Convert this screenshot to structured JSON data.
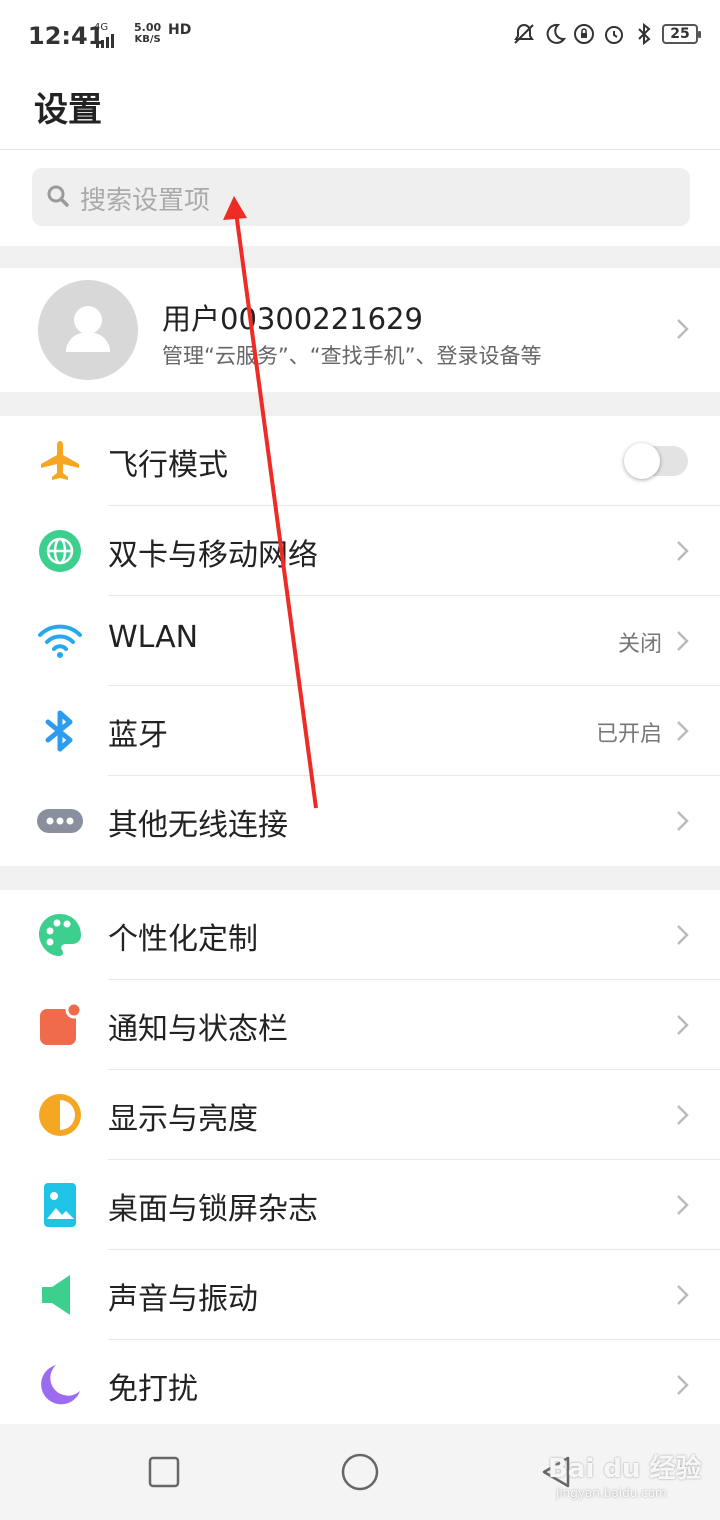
{
  "status_bar": {
    "time": "12:41",
    "network": "4G",
    "speed_value": "5.00",
    "speed_unit": "KB/S",
    "hd": "HD",
    "battery": "25"
  },
  "header": {
    "title": "设置"
  },
  "search": {
    "placeholder": "搜索设置项"
  },
  "account": {
    "name": "用户00300221629",
    "description": "管理“云服务”、“查找手机”、登录设备等"
  },
  "network_group": [
    {
      "label": "飞行模式",
      "icon": "airplane-icon",
      "control": "toggle",
      "on": false
    },
    {
      "label": "双卡与移动网络",
      "icon": "globe-icon"
    },
    {
      "label": "WLAN",
      "icon": "wifi-icon",
      "value": "关闭"
    },
    {
      "label": "蓝牙",
      "icon": "bluetooth-icon",
      "value": "已开启"
    },
    {
      "label": "其他无线连接",
      "icon": "more-dots-icon"
    }
  ],
  "system_group": [
    {
      "label": "个性化定制",
      "icon": "palette-icon"
    },
    {
      "label": "通知与状态栏",
      "icon": "notification-icon"
    },
    {
      "label": "显示与亮度",
      "icon": "brightness-icon"
    },
    {
      "label": "桌面与锁屏杂志",
      "icon": "wallpaper-icon"
    },
    {
      "label": "声音与振动",
      "icon": "speaker-icon"
    },
    {
      "label": "免打扰",
      "icon": "moon-icon"
    }
  ],
  "colors": {
    "airplane": "#f5a623",
    "globe": "#3ccf8e",
    "wifi": "#26a8f0",
    "bluetooth": "#2d9cf0",
    "more": "#8a8f9e",
    "palette": "#3ccf8e",
    "notification": "#f06a4c",
    "brightness": "#f5a623",
    "wallpaper": "#1ec3e6",
    "speaker": "#3ccf8e",
    "moon": "#9b6cf0",
    "annotation_arrow": "#ee2b24"
  },
  "watermark": {
    "text": "Bai du 经验",
    "sub": "jingyan.baidu.com"
  }
}
